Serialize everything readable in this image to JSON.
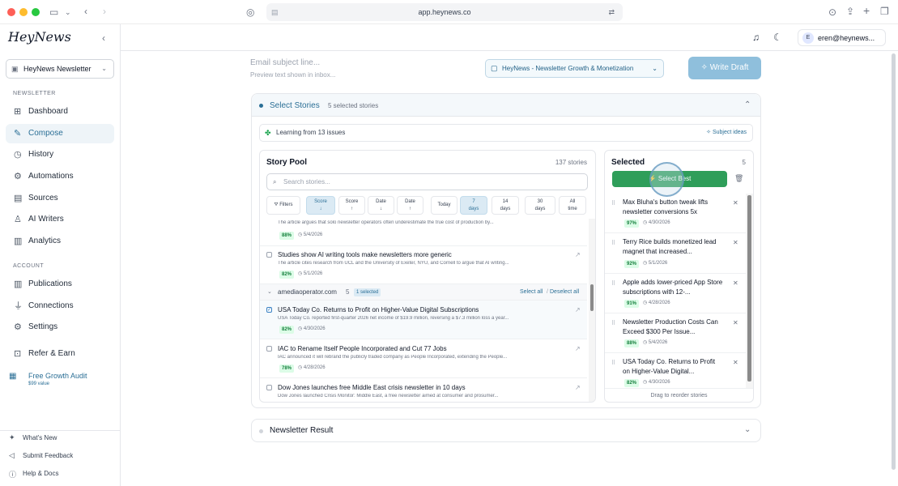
{
  "browser": {
    "url": "app.heynews.co",
    "traffic_colors": [
      "#fe5f57",
      "#febc2e",
      "#28c840"
    ]
  },
  "sidebar": {
    "logo": "HeyNews",
    "newsletter_select": "HeyNews Newsletter",
    "section_newsletter": "NEWSLETTER",
    "section_account": "ACCOUNT",
    "nav_newsletter": [
      {
        "label": "Dashboard",
        "icon": "grid-icon"
      },
      {
        "label": "Compose",
        "icon": "compose-icon",
        "active": true
      },
      {
        "label": "History",
        "icon": "clock-icon"
      },
      {
        "label": "Automations",
        "icon": "automation-icon"
      },
      {
        "label": "Sources",
        "icon": "document-icon"
      },
      {
        "label": "AI Writers",
        "icon": "user-icon"
      },
      {
        "label": "Analytics",
        "icon": "chart-icon"
      }
    ],
    "nav_account": [
      {
        "label": "Publications",
        "icon": "library-icon"
      },
      {
        "label": "Connections",
        "icon": "plug-icon"
      },
      {
        "label": "Settings",
        "icon": "gear-icon"
      }
    ],
    "refer": "Refer & Earn",
    "audit": {
      "label": "Free Growth Audit",
      "sub": "$99 value"
    },
    "footer": [
      "What's New",
      "Submit Feedback",
      "Help & Docs"
    ]
  },
  "topbar": {
    "user_email": "eren@heynews...",
    "avatar": "E"
  },
  "compose": {
    "subject_placeholder": "Email subject line...",
    "preview_placeholder": "Preview text shown in inbox...",
    "publication": "HeyNews - Newsletter Growth & Monetization",
    "write_draft": "Write Draft"
  },
  "select_stories": {
    "title": "Select Stories",
    "count": "5 selected stories",
    "learning": "Learning from 13 issues",
    "subject_ideas": "Subject ideas",
    "pool": {
      "title": "Story Pool",
      "count": "137 stories",
      "search_placeholder": "Search stories...",
      "filters": "Filters",
      "sorts": [
        {
          "l1": "Score",
          "l2": "↓",
          "on": true
        },
        {
          "l1": "Score",
          "l2": "↑"
        },
        {
          "l1": "Date",
          "l2": "↓"
        },
        {
          "l1": "Date",
          "l2": "↑"
        }
      ],
      "ranges": [
        {
          "l1": "Today",
          "l2": ""
        },
        {
          "l1": "7",
          "l2": "days",
          "on": true
        },
        {
          "l1": "14",
          "l2": "days"
        },
        {
          "l1": "30",
          "l2": "days"
        },
        {
          "l1": "All",
          "l2": "time"
        }
      ],
      "partial_item": {
        "desc": "The article argues that solo newsletter operators often underestimate the true cost of production by...",
        "score": "88%",
        "date": "5/4/2026"
      },
      "item1": {
        "title": "Studies show AI writing tools make newsletters more generic",
        "desc": "The article cites research from UCL and the University of Exeter, NYU, and Cornell to argue that AI writing...",
        "score": "82%",
        "date": "5/1/2026"
      },
      "group": {
        "name": "amediaoperator.com",
        "count": "5",
        "selected": "1 selected",
        "select_all": "Select all",
        "sep": "/",
        "deselect_all": "Deselect all"
      },
      "group_items": [
        {
          "title": "USA Today Co. Returns to Profit on Higher-Value Digital Subscriptions",
          "desc": "USA Today Co. reported first-quarter 2026 net income of $19.9 million, reversing a $7.3 million loss a year...",
          "score": "82%",
          "date": "4/30/2026",
          "checked": true
        },
        {
          "title": "IAC to Rename Itself People Incorporated and Cut 77 Jobs",
          "desc": "IAC announced it will rebrand the publicly traded company as People Incorporated, extending the People...",
          "score": "78%",
          "date": "4/28/2026"
        },
        {
          "title": "Dow Jones launches free Middle East crisis newsletter in 10 days",
          "desc": "Dow Jones launched Crisis Monitor: Middle East, a free newsletter aimed at consumer and prosumer..."
        }
      ]
    },
    "selected": {
      "title": "Selected",
      "count": "5",
      "select_best": "Select Best",
      "items": [
        {
          "title": "Max Bluha's button tweak lifts newsletter conversions 5x",
          "score": "97%",
          "date": "4/30/2026"
        },
        {
          "title": "Terry Rice builds monetized lead magnet that increased...",
          "score": "92%",
          "date": "5/1/2026"
        },
        {
          "title": "Apple adds lower-priced App Store subscriptions with 12-...",
          "score": "91%",
          "date": "4/28/2026"
        },
        {
          "title": "Newsletter Production Costs Can Exceed $300 Per Issue...",
          "score": "88%",
          "date": "5/4/2026"
        },
        {
          "title": "USA Today Co. Returns to Profit on Higher-Value Digital...",
          "score": "82%",
          "date": "4/30/2026"
        }
      ],
      "drag_hint": "Drag to reorder stories"
    }
  },
  "newsletter_result": {
    "title": "Newsletter Result"
  }
}
